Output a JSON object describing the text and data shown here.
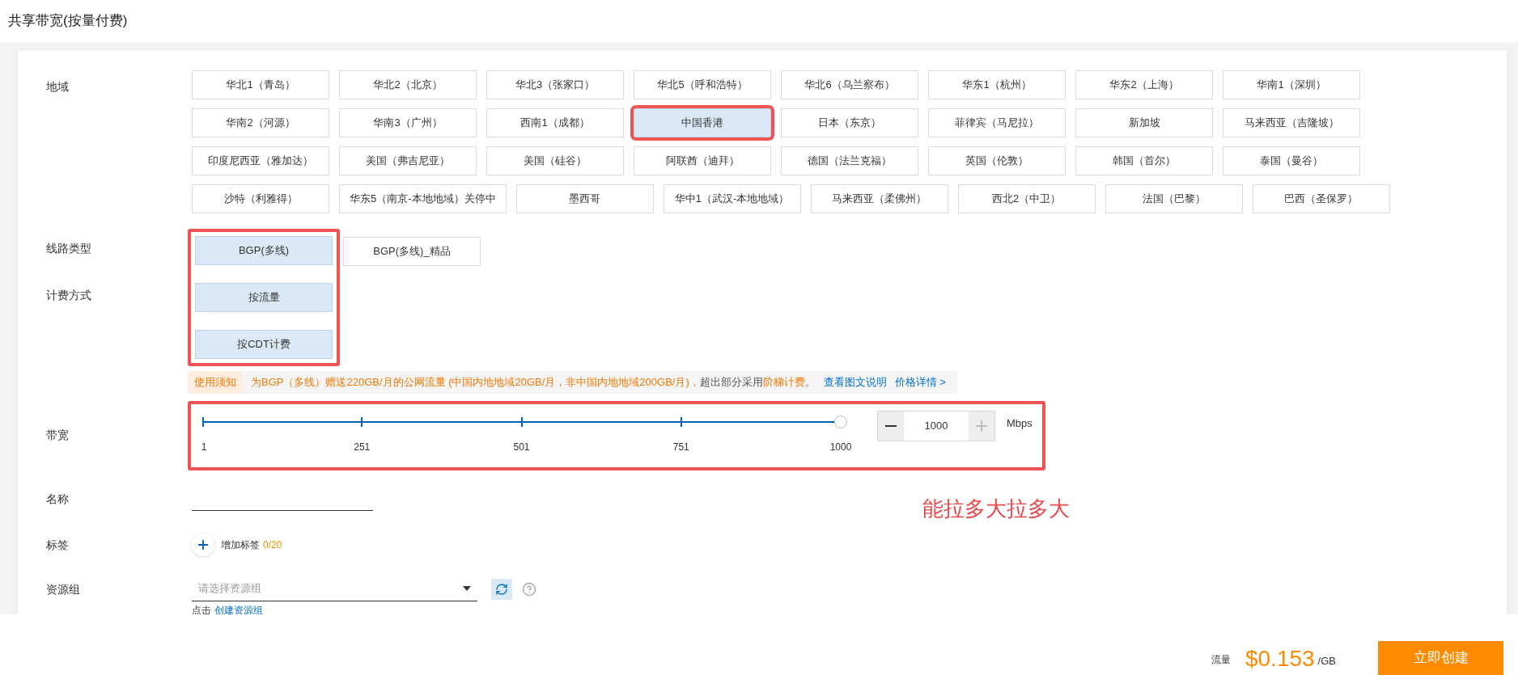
{
  "title": "共享带宽(按量付费)",
  "region": {
    "label": "地域",
    "options": [
      {
        "label": "华北1（青岛）",
        "selected": false,
        "highlighted": false
      },
      {
        "label": "华北2（北京）",
        "selected": false,
        "highlighted": false
      },
      {
        "label": "华北3（张家口）",
        "selected": false,
        "highlighted": false
      },
      {
        "label": "华北5（呼和浩特）",
        "selected": false,
        "highlighted": false
      },
      {
        "label": "华北6（乌兰察布）",
        "selected": false,
        "highlighted": false
      },
      {
        "label": "华东1（杭州）",
        "selected": false,
        "highlighted": false
      },
      {
        "label": "华东2（上海）",
        "selected": false,
        "highlighted": false
      },
      {
        "label": "华南1（深圳）",
        "selected": false,
        "highlighted": false
      },
      {
        "label": "华南2（河源）",
        "selected": false,
        "highlighted": false
      },
      {
        "label": "华南3（广州）",
        "selected": false,
        "highlighted": false
      },
      {
        "label": "西南1（成都）",
        "selected": false,
        "highlighted": false
      },
      {
        "label": "中国香港",
        "selected": true,
        "highlighted": true
      },
      {
        "label": "日本（东京）",
        "selected": false,
        "highlighted": false
      },
      {
        "label": "菲律宾（马尼拉）",
        "selected": false,
        "highlighted": false
      },
      {
        "label": "新加坡",
        "selected": false,
        "highlighted": false
      },
      {
        "label": "马来西亚（吉隆坡）",
        "selected": false,
        "highlighted": false
      },
      {
        "label": "印度尼西亚（雅加达）",
        "selected": false,
        "highlighted": false
      },
      {
        "label": "美国（弗吉尼亚）",
        "selected": false,
        "highlighted": false
      },
      {
        "label": "美国（硅谷）",
        "selected": false,
        "highlighted": false
      },
      {
        "label": "阿联酋（迪拜）",
        "selected": false,
        "highlighted": false
      },
      {
        "label": "德国（法兰克福）",
        "selected": false,
        "highlighted": false
      },
      {
        "label": "英国（伦敦）",
        "selected": false,
        "highlighted": false
      },
      {
        "label": "韩国（首尔）",
        "selected": false,
        "highlighted": false
      },
      {
        "label": "泰国（曼谷）",
        "selected": false,
        "highlighted": false
      },
      {
        "label": "沙特（利雅得）",
        "selected": false,
        "highlighted": false
      },
      {
        "label": "华东5（南京-本地地域）关停中",
        "selected": false,
        "highlighted": false
      },
      {
        "label": "墨西哥",
        "selected": false,
        "highlighted": false
      },
      {
        "label": "华中1（武汉-本地地域）",
        "selected": false,
        "highlighted": false
      },
      {
        "label": "马来西亚（柔佛州）",
        "selected": false,
        "highlighted": false
      },
      {
        "label": "西北2（中卫）",
        "selected": false,
        "highlighted": false
      },
      {
        "label": "法国（巴黎）",
        "selected": false,
        "highlighted": false
      },
      {
        "label": "巴西（圣保罗）",
        "selected": false,
        "highlighted": false
      }
    ]
  },
  "line_type": {
    "label": "线路类型",
    "highlighted": true,
    "options": [
      {
        "label": "BGP(多线)",
        "selected": true
      },
      {
        "label": "BGP(多线)_精品",
        "selected": false
      }
    ]
  },
  "billing": {
    "label": "计费方式",
    "options": [
      {
        "label": "按流量",
        "selected": true
      },
      {
        "label": "按CDT计费",
        "selected": true
      }
    ]
  },
  "notice": {
    "tag": "使用须知",
    "segments": [
      {
        "kind": "highlight",
        "text": "为BGP（多线）赠送220GB/月的公网流量 (中国内地地域20GB/月，非中国内地地域200GB/月)，"
      },
      {
        "kind": "plain",
        "text": "超出部分采用"
      },
      {
        "kind": "highlight",
        "text": "阶梯计费"
      },
      {
        "kind": "plain",
        "text": "。"
      }
    ],
    "links": [
      "查看图文说明",
      "价格详情 >"
    ]
  },
  "bandwidth": {
    "label": "带宽",
    "highlighted": true,
    "slider": {
      "level": 1.0,
      "ticks": [
        "1",
        "251",
        "501",
        "751",
        "1000"
      ]
    },
    "stepper": {
      "value": "1000",
      "minus_disabled": false,
      "plus_disabled": true
    },
    "unit": "Mbps"
  },
  "name": {
    "label": "名称"
  },
  "tags": {
    "label": "标签",
    "add": "增加标签",
    "count": "0/20"
  },
  "resource_group": {
    "label": "资源组",
    "placeholder": "请选择资源组",
    "hint": "点击",
    "link": "创建资源组"
  },
  "annotation": "能拉多大拉多大",
  "footer": {
    "price_label": "流量",
    "price": "$0.153",
    "price_unit": "/GB",
    "button": "立即创建"
  }
}
